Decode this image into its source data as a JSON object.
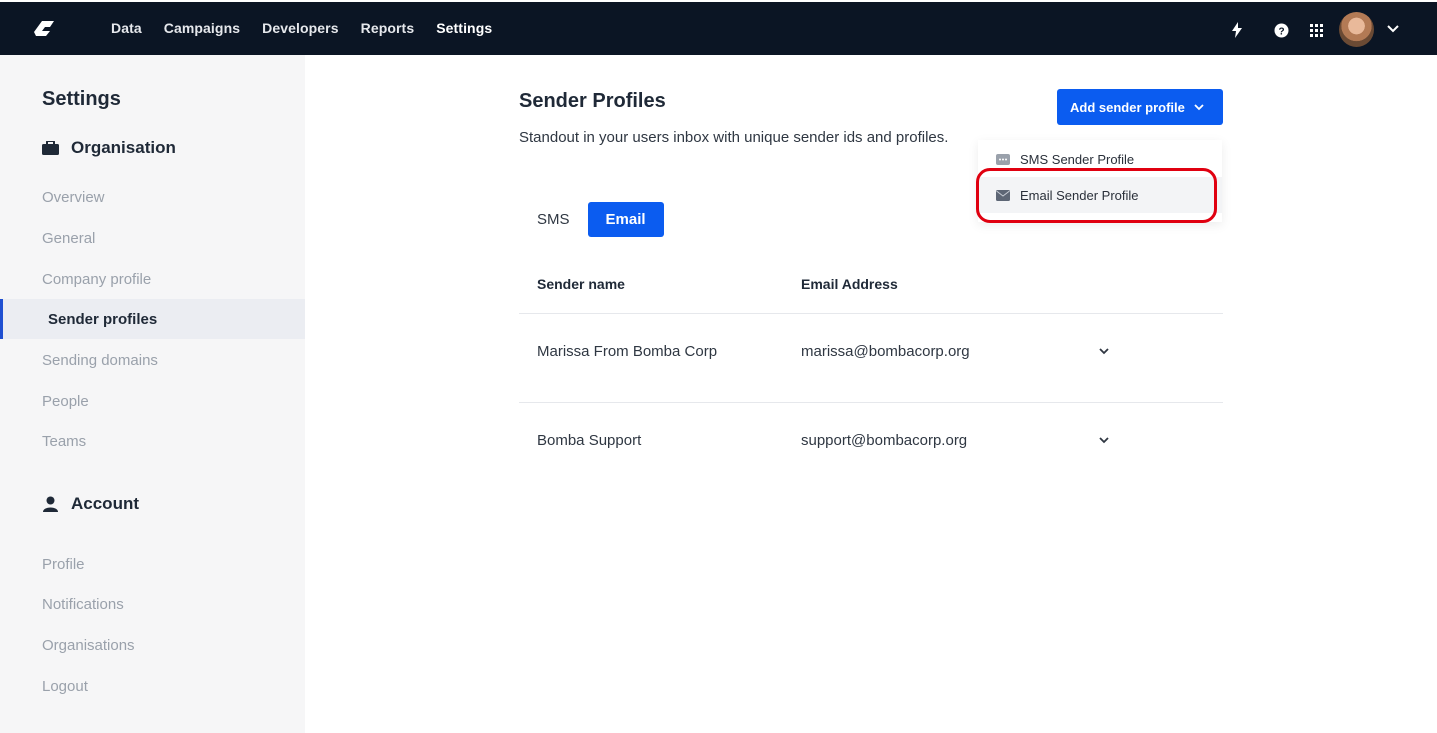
{
  "topbar": {
    "nav": [
      "Data",
      "Campaigns",
      "Developers",
      "Reports",
      "Settings"
    ],
    "active_nav": "Settings"
  },
  "sidebar": {
    "title": "Settings",
    "organisation": {
      "label": "Organisation",
      "items": [
        "Overview",
        "General",
        "Company profile",
        "Sender profiles",
        "Sending domains",
        "People",
        "Teams"
      ],
      "active": "Sender profiles"
    },
    "account": {
      "label": "Account",
      "items": [
        "Profile",
        "Notifications",
        "Organisations",
        "Logout"
      ]
    }
  },
  "main": {
    "title": "Sender Profiles",
    "subtitle": "Standout in your users inbox with unique sender ids and profiles.",
    "add_button": "Add sender profile",
    "dropdown": [
      "SMS Sender Profile",
      "Email Sender Profile"
    ],
    "tabs": [
      "SMS",
      "Email"
    ],
    "active_tab": "Email",
    "table": {
      "headers": [
        "Sender name",
        "Email Address"
      ],
      "rows": [
        {
          "name": "Marissa From Bomba Corp",
          "email": "marissa@bombacorp.org"
        },
        {
          "name": "Bomba Support",
          "email": "support@bombacorp.org"
        }
      ]
    }
  },
  "colors": {
    "topbar": "#0b1524",
    "accent": "#0b5cf0",
    "highlight": "#e00010"
  }
}
